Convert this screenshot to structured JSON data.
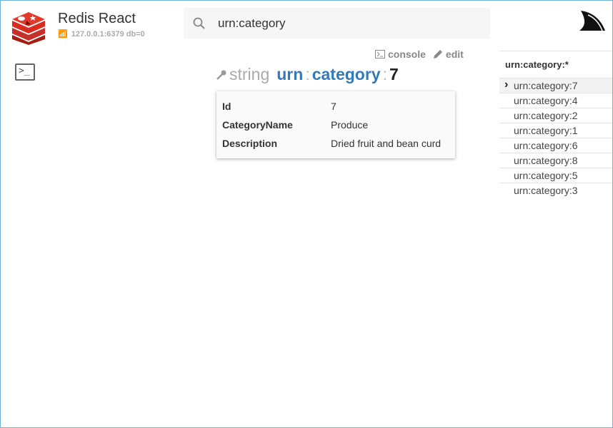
{
  "app": {
    "title": "Redis React",
    "connection": "127.0.0.1:6379 db=0"
  },
  "search": {
    "value": "urn:category"
  },
  "actions": {
    "console": "console",
    "edit": "edit"
  },
  "key": {
    "type": "string",
    "segments": [
      "urn",
      "category"
    ],
    "last": "7",
    "separator": ":"
  },
  "record": [
    {
      "key": "Id",
      "value": "7"
    },
    {
      "key": "CategoryName",
      "value": "Produce"
    },
    {
      "key": "Description",
      "value": "Dried fruit and bean curd"
    }
  ],
  "sidebar": {
    "pattern": "urn:category:*",
    "items": [
      "urn:category:7",
      "urn:category:4",
      "urn:category:2",
      "urn:category:1",
      "urn:category:6",
      "urn:category:8",
      "urn:category:5",
      "urn:category:3"
    ],
    "selected": 0
  }
}
